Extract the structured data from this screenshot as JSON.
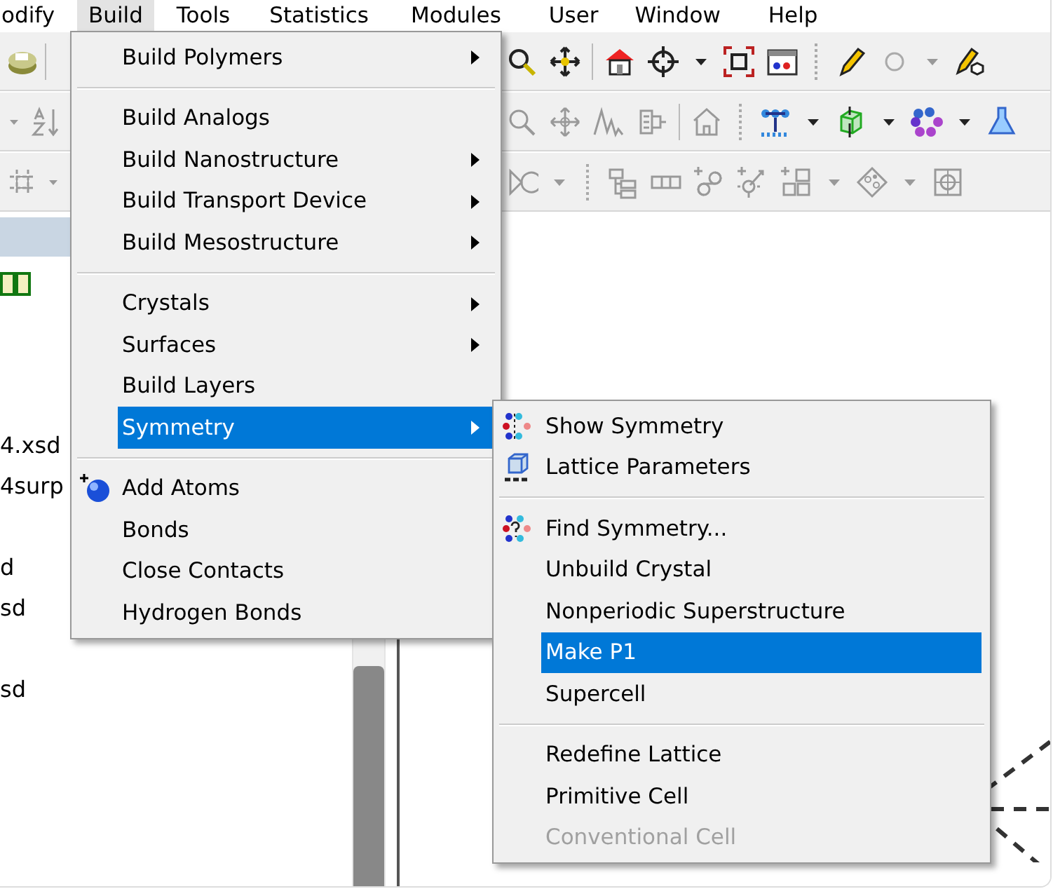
{
  "menubar": {
    "items": [
      {
        "label": "odify",
        "selected": false
      },
      {
        "label": "Build",
        "selected": true
      },
      {
        "label": "Tools",
        "selected": false
      },
      {
        "label": "Statistics",
        "selected": false
      },
      {
        "label": "Modules",
        "selected": false
      },
      {
        "label": "User",
        "selected": false
      },
      {
        "label": "Window",
        "selected": false
      },
      {
        "label": "Help",
        "selected": false
      }
    ]
  },
  "explorer": {
    "file_groups": [
      {
        "items": [
          "4.xsd",
          "4surp"
        ]
      },
      {
        "items": [
          "d",
          "sd"
        ]
      },
      {
        "items": [
          "sd"
        ]
      }
    ]
  },
  "build_menu": {
    "sections": [
      {
        "items": [
          {
            "label": "Build Polymers",
            "kind": "plain",
            "submenu": true,
            "selected": false
          }
        ]
      },
      {
        "items": [
          {
            "label": "Build Analogs",
            "kind": "plain",
            "submenu": false,
            "selected": false
          },
          {
            "label": "Build Nanostructure",
            "kind": "plain",
            "submenu": true,
            "selected": false
          },
          {
            "label": "Build Transport Device",
            "kind": "plain",
            "submenu": true,
            "selected": false
          },
          {
            "label": "Build Mesostructure",
            "kind": "plain",
            "submenu": true,
            "selected": false
          }
        ]
      },
      {
        "items": [
          {
            "label": "Crystals",
            "kind": "plain",
            "submenu": true,
            "selected": false
          },
          {
            "label": "Surfaces",
            "kind": "plain",
            "submenu": true,
            "selected": false
          },
          {
            "label": "Build Layers",
            "kind": "plain",
            "submenu": false,
            "selected": false
          },
          {
            "label": "Symmetry",
            "kind": "plain",
            "submenu": true,
            "selected": true
          }
        ]
      },
      {
        "items": [
          {
            "label": "Add Atoms",
            "kind": "ball",
            "submenu": false,
            "selected": false
          },
          {
            "label": "Bonds",
            "kind": "plain",
            "submenu": false,
            "selected": false
          },
          {
            "label": "Close Contacts",
            "kind": "plain",
            "submenu": false,
            "selected": false
          },
          {
            "label": "Hydrogen Bonds",
            "kind": "plain",
            "submenu": false,
            "selected": false
          }
        ]
      }
    ]
  },
  "symmetry_menu": {
    "sections": [
      {
        "items": [
          {
            "label": "Show Symmetry",
            "kind": "dots",
            "selected": false,
            "disabled": false
          },
          {
            "label": "Lattice Parameters",
            "kind": "cube",
            "selected": false,
            "disabled": false
          }
        ]
      },
      {
        "items": [
          {
            "label": "Find Symmetry...",
            "kind": "dots-query",
            "selected": false,
            "disabled": false
          },
          {
            "label": "Unbuild Crystal",
            "kind": "plain",
            "selected": false,
            "disabled": false
          },
          {
            "label": "Nonperiodic Superstructure",
            "kind": "plain",
            "selected": false,
            "disabled": false
          },
          {
            "label": "Make P1",
            "kind": "plain",
            "selected": true,
            "disabled": false
          },
          {
            "label": "Supercell",
            "kind": "plain",
            "selected": false,
            "disabled": false
          }
        ]
      },
      {
        "items": [
          {
            "label": "Redefine Lattice",
            "kind": "plain",
            "selected": false,
            "disabled": false
          },
          {
            "label": "Primitive Cell",
            "kind": "plain",
            "selected": false,
            "disabled": false
          },
          {
            "label": "Conventional Cell",
            "kind": "plain",
            "selected": false,
            "disabled": true
          }
        ]
      }
    ]
  }
}
